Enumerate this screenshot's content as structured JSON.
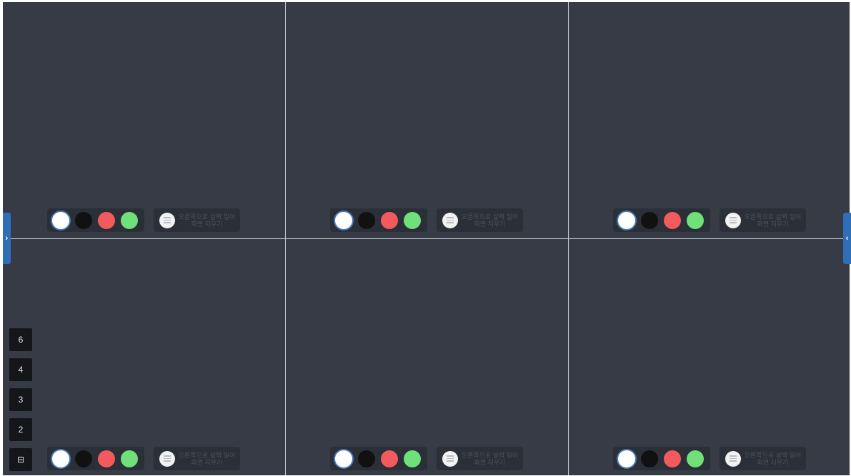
{
  "colors": {
    "board_bg": "#363b45",
    "toolbar_bg": "#2b2f37",
    "swatches": [
      "#ffffff",
      "#111111",
      "#f25a5e",
      "#6fe07a"
    ],
    "tab_blue": "#2f6fb8"
  },
  "panels": [
    {
      "clear_label": "오른쪽으로 살짝 밀어 화면 지우기"
    },
    {
      "clear_label": "오른쪽으로 살짝 밀어 화면 지우기"
    },
    {
      "clear_label": "오른쪽으로 살짝 밀어 화면 지우기"
    },
    {
      "clear_label": "오른쪽으로 살짝 밀어 화면 지우기"
    },
    {
      "clear_label": "오른쪽으로 살짝 밀어 화면 지우기"
    },
    {
      "clear_label": "오른쪽으로 살짝 밀어 화면 지우기"
    }
  ],
  "side_tabs": {
    "left_glyph": "›",
    "right_glyph": "‹"
  },
  "layout_buttons": [
    "6",
    "4",
    "3",
    "2"
  ],
  "exit_button": {
    "icon": "exit-icon",
    "glyph": "⊟"
  }
}
